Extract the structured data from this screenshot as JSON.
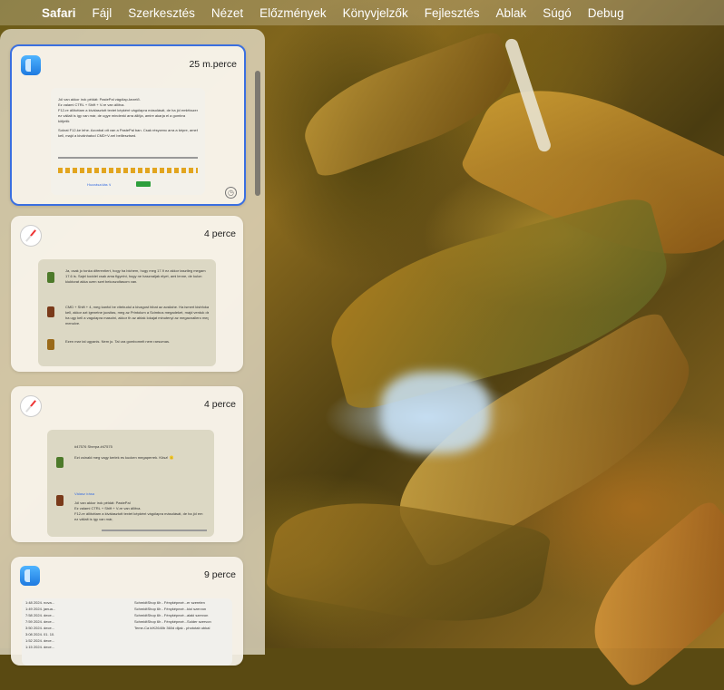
{
  "menubar": {
    "apple": "",
    "items": [
      "Safari",
      "Fájl",
      "Szerkesztés",
      "Nézet",
      "Előzmények",
      "Könyvjelzők",
      "Fejlesztés",
      "Ablak",
      "Súgó",
      "Debug"
    ]
  },
  "cards": [
    {
      "app_icon": "finder-icon",
      "time": "25 m.perce",
      "selected": true,
      "thumb_lines": [
        "Jól van akkor írok példát: PastePal vágólap-kezelő.",
        "Ez valami CTRL + Shift + V-re van állítva.",
        "F12-re állítottam a kiválasztott textet képként vágólapra másolását, de ha jól emlékszem",
        "ez vállalt is így van már, de ugye mindenki arra állítja, amire akarja el a gombra",
        "kötjetik",
        "Sokrat F12-ke lehe. Azonbal ott van a PastePal ban. Csak résyzenc arra a képre, amelyik",
        "kell, majd a kiválnhatod CMD+V-nel beillesztsed."
      ],
      "footer_label": "Hozzászólás ∨",
      "badge": "Küldés"
    },
    {
      "app_icon": "safari-icon",
      "time": "4 perce",
      "thumb_lines": [
        "Ja, csak jo tonka diferentiert, hogy ha bichem, hogy meg 17.9 ez akkor tasztleg megam",
        "17.6 is. Sajel koddel csak ama figyelni, hogy ne hasznaljak elyet, ami lenne, de kulon",
        "kiuktorat akka ozen szet bekoszoltasom van.",
        "CMD + Shift + 4, meg kanfol be vitebudul a kivagost hibat az acsilahe. Ha ismert kishfokam",
        "kell, akkor azt igenetne jucsitas, meg az Printolum a Scimbus megadeket, majd verduk de",
        "ha ugy kell a vagolapra masolni, akkor th az ablak lokajat minutenyi az megacnallero mega",
        "menulve.",
        "Ezen mar tal ugyanis. Nem jo. Tal ura gombomelt nem rarsumas."
      ]
    },
    {
      "app_icon": "safari-icon",
      "time": "4 perce",
      "thumb_lines": [
        "#47576 Sherpa #47575",
        "Ezt csinald meg vagy kerlek es kucken megaperrek. Kösz! 🙂",
        "Válasz írása",
        "Jól van akkor írok példát: PastePal",
        "Ez valami CTRL + Shift + V-re van állítva.",
        "F12-re állítottam a kiválasztott textet képként vágólapra másolását, de ha jól em",
        "ez vállalt is így van már,"
      ]
    },
    {
      "app_icon": "finder-icon",
      "time": "9 perce",
      "thumb_lines": [
        "1:48  2024. nova...",
        "1:49  2024. janua...",
        "7:58  2024. dece...",
        "7:59  2024. dece...",
        "3:50  2024. dece...",
        "3:08  2024. 01. 10.",
        "1:52  2024. dece...",
        "1:15  2024. dece..."
      ],
      "right_lines": [
        "SchmidtShop 6h - Fényképezé...er szerelen",
        "SchmidtShop 6h - Fényképezé...kioi szervon",
        "SchmidtShop 6h - Fényképezé...alaki szervon",
        "SchmidtShop 6h - Fényképezé...Solder szervon",
        "Teme-Ca kIK2640b 360d dijak - phototab ubkal"
      ]
    }
  ]
}
